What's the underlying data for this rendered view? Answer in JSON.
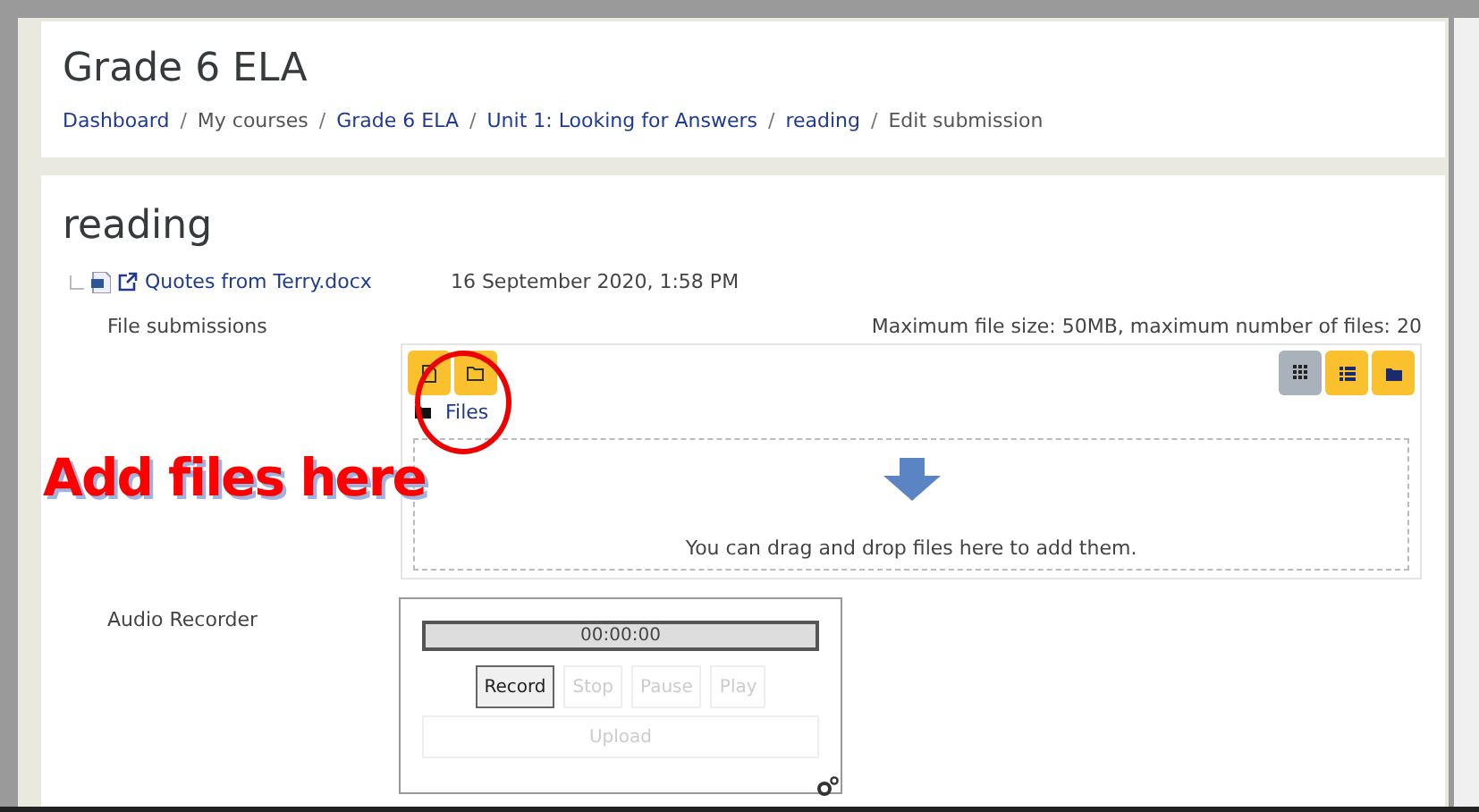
{
  "header": {
    "title": "Grade 6 ELA",
    "separator": "/",
    "breadcrumbs": [
      {
        "label": "Dashboard",
        "kind": "link"
      },
      {
        "label": "My courses",
        "kind": "text"
      },
      {
        "label": "Grade 6 ELA",
        "kind": "link"
      },
      {
        "label": "Unit 1: Looking for Answers",
        "kind": "link"
      },
      {
        "label": "reading",
        "kind": "link"
      },
      {
        "label": "Edit submission",
        "kind": "text"
      }
    ]
  },
  "main": {
    "title": "reading",
    "attachment": {
      "name": "Quotes from Terry.docx",
      "date": "16 September 2020, 1:58 PM"
    },
    "file_submissions": {
      "label": "File submissions",
      "limits": "Maximum file size: 50MB, maximum number of files: 20",
      "path": "Files",
      "view_buttons": [
        {
          "kind": "grid",
          "selected": true
        },
        {
          "kind": "list",
          "selected": false
        },
        {
          "kind": "tree",
          "selected": false
        }
      ],
      "drop_hint": "You can drag and drop files here to add them."
    },
    "audio_recorder": {
      "label": "Audio Recorder",
      "timer": "00:00:00",
      "buttons": [
        {
          "label": "Record",
          "disabled": false
        },
        {
          "label": "Stop",
          "disabled": true
        },
        {
          "label": "Pause",
          "disabled": true
        },
        {
          "label": "Play",
          "disabled": true
        }
      ],
      "upload": {
        "label": "Upload",
        "disabled": true
      }
    }
  },
  "annotation": {
    "text": "Add files here"
  }
}
